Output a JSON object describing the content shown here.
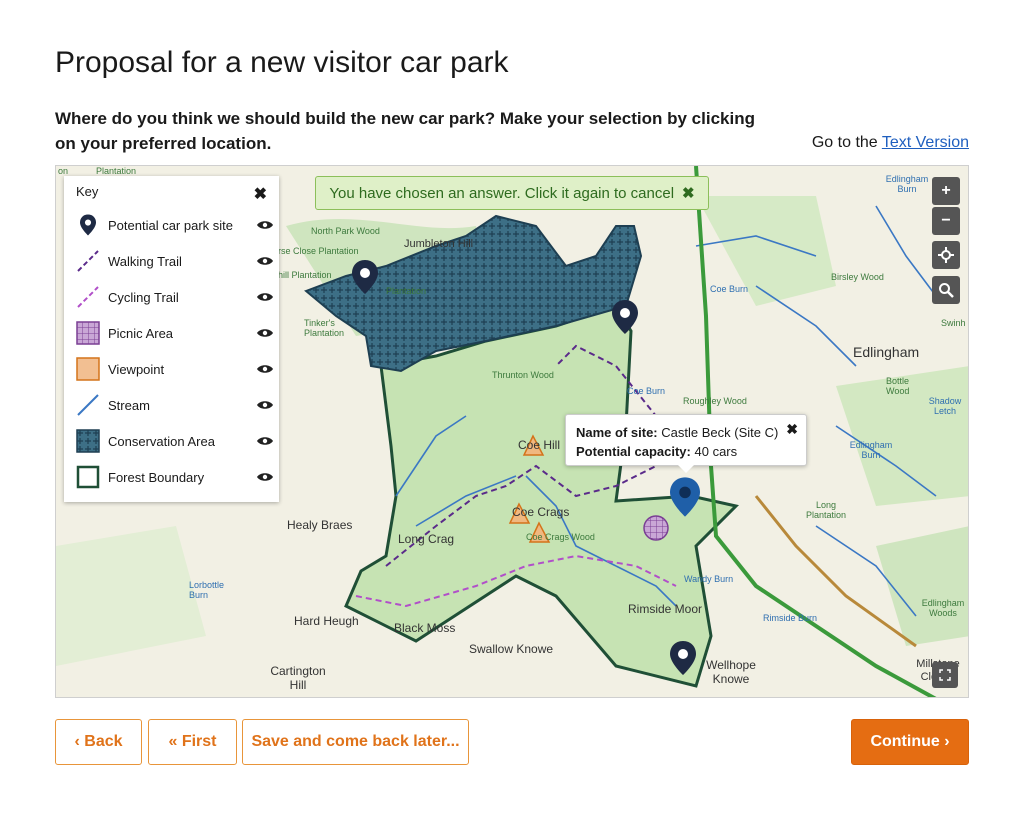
{
  "page": {
    "title": "Proposal for a new visitor car park",
    "question": "Where do you think we should build the new car park? Make your selection by clicking on your preferred location.",
    "text_version_prefix": "Go to the ",
    "text_version_link": "Text Version"
  },
  "map": {
    "banner": "You have chosen an answer. Click it again to cancel",
    "banner_close": "✖",
    "controls": {
      "zoom_in": "+",
      "zoom_out": "−"
    },
    "key": {
      "title": "Key",
      "close": "✖",
      "items": [
        {
          "label": "Potential car park site",
          "icon": "map-pin-icon"
        },
        {
          "label": "Walking Trail",
          "icon": "walking-trail-icon"
        },
        {
          "label": "Cycling Trail",
          "icon": "cycling-trail-icon"
        },
        {
          "label": "Picnic Area",
          "icon": "picnic-area-icon"
        },
        {
          "label": "Viewpoint",
          "icon": "viewpoint-icon"
        },
        {
          "label": "Stream",
          "icon": "stream-icon"
        },
        {
          "label": "Conservation Area",
          "icon": "conservation-area-icon"
        },
        {
          "label": "Forest Boundary",
          "icon": "forest-boundary-icon"
        }
      ]
    },
    "popup": {
      "name_label": "Name of site:",
      "name_value": "Castle Beck (Site C)",
      "capacity_label": "Potential capacity:",
      "capacity_value": "40 cars",
      "close": "✖"
    },
    "labels": {
      "plantation_top": "Plantation",
      "on": "on",
      "north_park_wood": "North Park Wood",
      "jumbleton_hill": "Jumbleton Hill",
      "rse_close_plantation": "rse Close Plantation",
      "hill_plantation": "hill Plantation",
      "plantation_mid": "Plantation",
      "tinkers_plantation": "Tinker's Plantation",
      "thrunton_wood": "Thrunton Wood",
      "coe_hill": "Coe Hill",
      "coe_crags": "Coe Crags",
      "coe_crags_wood": "Coe Crags Wood",
      "healy_braes": "Healy Braes",
      "long_crag": "Long Crag",
      "lorbottle_burn": "Lorbottle Burn",
      "hard_heugh": "Hard Heugh",
      "black_moss": "Black Moss",
      "swallow_knowe": "Swallow Knowe",
      "cartington_hill": "Cartington Hill",
      "rimside_moor": "Rimside Moor",
      "wellhope_knowe": "Wellhope Knowe",
      "wandy_burn": "Wandy Burn",
      "rimside_burn": "Rimside Burn",
      "long_plantation": "Long Plantation",
      "edlingham": "Edlingham",
      "edlingham_burn_top": "Edlingham Burn",
      "edlingham_burn_mid": "Edlingham Burn",
      "edlingham_woods": "Edlingham Woods",
      "coe_burn": "Coe Burn",
      "coe_burn2": "Coe Burn",
      "birsley_wood": "Birsley Wood",
      "roughley_wood": "Roughley Wood",
      "bottle_wood": "Bottle Wood",
      "swinh": "Swinh",
      "millstone_cleugh": "Millstone Cleugh",
      "shadow_letch": "Shadow Letch"
    }
  },
  "buttons": {
    "back": "‹  Back",
    "first": "«  First",
    "save": "Save and come back later...",
    "continue": "Continue  ›"
  }
}
